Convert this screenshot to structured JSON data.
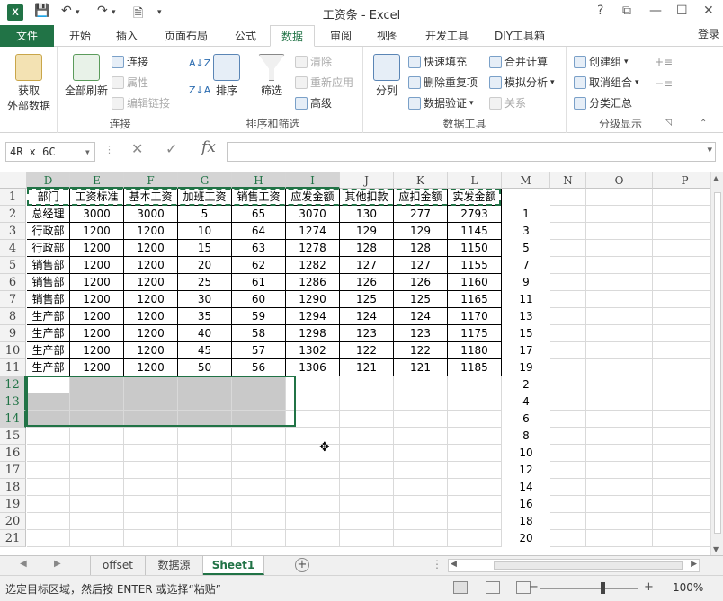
{
  "app": {
    "title": "工资条 - Excel",
    "logo_letter": "X",
    "quick_access": {
      "save_icon": "save-icon",
      "undo_icon": "undo-icon",
      "redo_icon": "redo-icon",
      "preview_icon": "print-preview-icon"
    },
    "window_buttons": {
      "help": "?",
      "restore": "⧉",
      "minimize": "—",
      "maximize": "☐",
      "close": "✕"
    }
  },
  "ribbon_tabs": {
    "file": "文件",
    "tabs": [
      "开始",
      "插入",
      "页面布局",
      "公式",
      "数据",
      "审阅",
      "视图",
      "开发工具",
      "DIY工具箱"
    ],
    "active_tab": "数据",
    "login": "登录"
  },
  "ribbon": {
    "get_external": {
      "label1": "获取",
      "label2": "外部数据"
    },
    "connections": {
      "refresh_all": "全部刷新",
      "connect": "连接",
      "properties": "属性",
      "edit_links": "编辑链接",
      "group": "连接"
    },
    "sort_filter": {
      "sort": "排序",
      "filter": "筛选",
      "clear": "清除",
      "reapply": "重新应用",
      "advanced": "高级",
      "group": "排序和筛选"
    },
    "data_tools": {
      "split": "分列",
      "flash_fill": "快速填充",
      "remove_dup": "删除重复项",
      "validation": "数据验证",
      "consolidate": "合并计算",
      "whatif": "模拟分析",
      "relations": "关系",
      "group": "数据工具"
    },
    "outline": {
      "group_btn": "创建组",
      "ungroup": "取消组合",
      "subtotal": "分类汇总",
      "group": "分级显示"
    }
  },
  "formula_bar": {
    "name_box": "4R x 6C",
    "formula": ""
  },
  "columns": [
    "D",
    "E",
    "F",
    "G",
    "H",
    "I",
    "J",
    "K",
    "L",
    "M",
    "N",
    "O",
    "P"
  ],
  "rows": [
    "1",
    "2",
    "3",
    "4",
    "5",
    "6",
    "7",
    "8",
    "9",
    "10",
    "11",
    "12",
    "13",
    "14",
    "15",
    "16",
    "17",
    "18",
    "19",
    "20",
    "21"
  ],
  "table": {
    "headers": [
      "部门",
      "工资标准",
      "基本工资",
      "加班工资",
      "销售工资",
      "应发金额",
      "其他扣款",
      "应扣金额",
      "实发金额"
    ],
    "rows": [
      [
        "总经理",
        "3000",
        "3000",
        "5",
        "65",
        "3070",
        "130",
        "277",
        "2793"
      ],
      [
        "行政部",
        "1200",
        "1200",
        "10",
        "64",
        "1274",
        "129",
        "129",
        "1145"
      ],
      [
        "行政部",
        "1200",
        "1200",
        "15",
        "63",
        "1278",
        "128",
        "128",
        "1150"
      ],
      [
        "销售部",
        "1200",
        "1200",
        "20",
        "62",
        "1282",
        "127",
        "127",
        "1155"
      ],
      [
        "销售部",
        "1200",
        "1200",
        "25",
        "61",
        "1286",
        "126",
        "126",
        "1160"
      ],
      [
        "销售部",
        "1200",
        "1200",
        "30",
        "60",
        "1290",
        "125",
        "125",
        "1165"
      ],
      [
        "生产部",
        "1200",
        "1200",
        "35",
        "59",
        "1294",
        "124",
        "124",
        "1170"
      ],
      [
        "生产部",
        "1200",
        "1200",
        "40",
        "58",
        "1298",
        "123",
        "123",
        "1175"
      ],
      [
        "生产部",
        "1200",
        "1200",
        "45",
        "57",
        "1302",
        "122",
        "122",
        "1180"
      ],
      [
        "生产部",
        "1200",
        "1200",
        "50",
        "56",
        "1306",
        "121",
        "121",
        "1185"
      ]
    ]
  },
  "column_m": [
    "1",
    "3",
    "5",
    "7",
    "9",
    "11",
    "13",
    "15",
    "17",
    "19",
    "2",
    "4",
    "6",
    "8",
    "10",
    "12",
    "14",
    "16",
    "18",
    "20"
  ],
  "sheets": {
    "tabs": [
      "offset",
      "数据源",
      "Sheet1"
    ],
    "active": "Sheet1"
  },
  "status": {
    "message": "选定目标区域，然后按 ENTER 或选择“粘贴”",
    "zoom": "100%"
  }
}
